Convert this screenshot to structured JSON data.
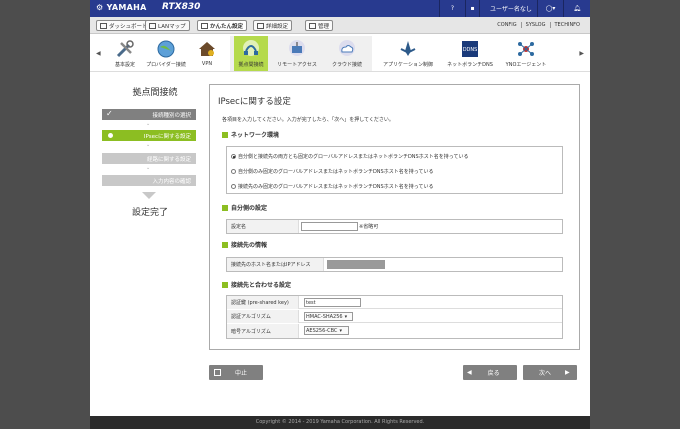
{
  "topbar": {
    "brand": "YAMAHA",
    "model": "RTX830",
    "help": "?",
    "user_label": "ユーザー名なし"
  },
  "menu": {
    "dashboard": "ダッシュボード",
    "lanmap": "LANマップ",
    "easy_setup": "かんたん設定",
    "detail_setup": "詳細設定",
    "admin": "管理",
    "links": [
      "CONFIG",
      "SYSLOG",
      "TECHINFO"
    ]
  },
  "iconbar": {
    "items": [
      {
        "label": "基本設定",
        "icon": "tools-icon"
      },
      {
        "label": "プロバイダー接続",
        "icon": "globe-icon"
      },
      {
        "label": "VPN",
        "icon": "house-key-icon"
      },
      {
        "label": "拠点間接続",
        "icon": "site-connection-icon"
      },
      {
        "label": "リモートアクセス",
        "icon": "remote-access-icon"
      },
      {
        "label": "クラウド接続",
        "icon": "cloud-icon"
      },
      {
        "label": "アプリケーション制御",
        "icon": "app-control-icon"
      },
      {
        "label": "ネットボランチDNS",
        "icon": "dns-icon"
      },
      {
        "label": "YNOエージェント",
        "icon": "yno-icon"
      }
    ]
  },
  "left": {
    "title": "拠点間接続",
    "steps": [
      "接続種別の選択",
      "IPsecに関する設定",
      "経路に関する設定",
      "入力内容の確認"
    ],
    "complete": "設定完了"
  },
  "panel": {
    "title": "IPsecに関する設定",
    "desc": "各項目を入力してください。入力が完了したら、「次へ」を押してください。",
    "network_env": {
      "heading": "ネットワーク環境",
      "options": [
        "自分側と接続先の両方とも固定のグローバルアドレスまたはネットボランチDNSホスト名を持っている",
        "自分側のみ固定のグローバルアドレスまたはネットボランチDNSホスト名を持っている",
        "接続先のみ固定のグローバルアドレスまたはネットボランチDNSホスト名を持っている"
      ]
    },
    "own": {
      "heading": "自分側の設定",
      "label": "設定名",
      "value": "",
      "note": "※省略可"
    },
    "peer": {
      "heading": "接続先の情報",
      "label": "接続先のホスト名またはIPアドレス",
      "value": ""
    },
    "match": {
      "heading": "接続先と合わせる設定",
      "psk_label": "認証鍵 (pre-shared key)",
      "psk_value": "test",
      "auth_label": "認証アルゴリズム",
      "auth_value": "HMAC-SHA256",
      "enc_label": "暗号アルゴリズム",
      "enc_value": "AES256-CBC"
    }
  },
  "buttons": {
    "cancel": "中止",
    "back": "戻る",
    "next": "次へ"
  },
  "footer": "Copyright © 2014 - 2019 Yamaha Corporation. All Rights Reserved."
}
